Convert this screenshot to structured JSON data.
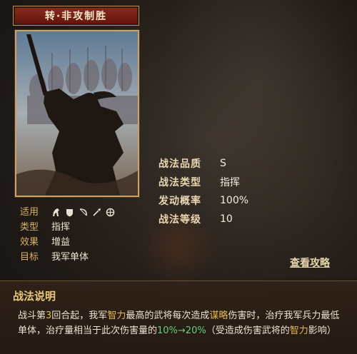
{
  "skill": {
    "name": "转·非攻制胜"
  },
  "tags": {
    "arms_label": "适用",
    "arm_icons": [
      "cavalry-icon",
      "shield-icon",
      "bow-icon",
      "spear-icon",
      "siege-icon"
    ],
    "type_label": "类型",
    "type_value": "指挥",
    "effect_label": "效果",
    "effect_value": "增益",
    "target_label": "目标",
    "target_value": "我军单体"
  },
  "stats": {
    "quality_label": "战法品质",
    "quality_value": "S",
    "kind_label": "战法类型",
    "kind_value": "指挥",
    "rate_label": "发动概率",
    "rate_value": "100%",
    "level_label": "战法等级",
    "level_value": "10"
  },
  "view_link": "查看攻略",
  "description": {
    "title": "战法说明",
    "p1": "战斗第",
    "p2": "3",
    "p3": "回合起，我军",
    "p4": "智力",
    "p5": "最高的武将每次造成",
    "p6": "谋略",
    "p7": "伤害时，治疗我军兵力最低单体，治疗量相当于此次伤害量的",
    "p8": "10%→20%",
    "p9": "（受造成伤害武将的",
    "p10": "智力",
    "p11": "影响）"
  },
  "colors": {
    "accent_gold": "#d8b35c",
    "highlight": "#e7b850",
    "percent_green": "#5fcf7a",
    "banner_red": "#8c2a1d"
  }
}
